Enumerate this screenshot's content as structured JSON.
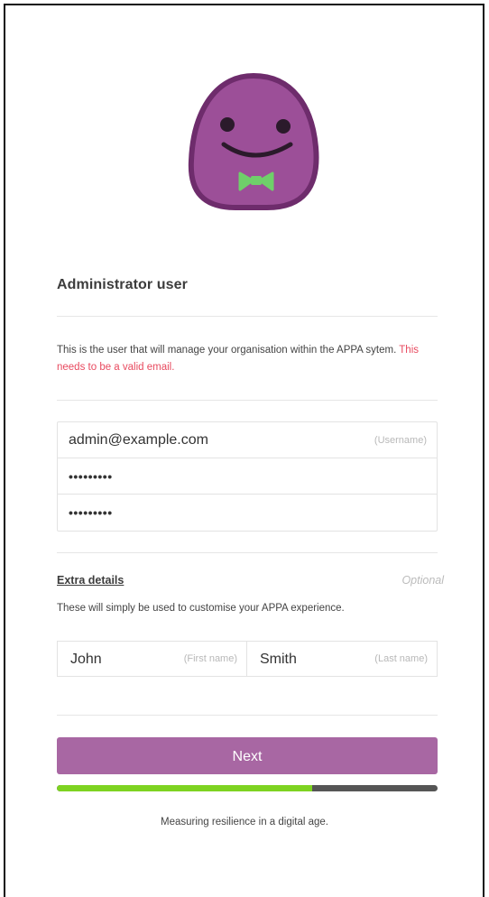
{
  "admin": {
    "heading": "Administrator user",
    "description": "This is the user that will manage your organisation within the APPA sytem.",
    "warning": "This needs to be a valid email.",
    "fields": [
      {
        "value": "admin@example.com",
        "hint": "(Username)"
      },
      {
        "value": "•••••••••",
        "hint": ""
      },
      {
        "value": "•••••••••",
        "hint": ""
      }
    ]
  },
  "extra": {
    "title": "Extra details",
    "optional_label": "Optional",
    "description": "These will simply be used to customise your APPA experience.",
    "first_name": {
      "value": "John",
      "hint": "(First name)"
    },
    "last_name": {
      "value": "Smith",
      "hint": "(Last name)"
    }
  },
  "actions": {
    "next_label": "Next"
  },
  "progress": {
    "fraction": 0.67,
    "fill_color": "#7ed321",
    "track_color": "#555555"
  },
  "footer": {
    "tagline": "Measuring resilience in a digital age."
  },
  "colors": {
    "brand": "#a867a3",
    "warning": "#e84a5f"
  },
  "mascot": {
    "icon": "smiling-blob-bowtie-mascot"
  }
}
